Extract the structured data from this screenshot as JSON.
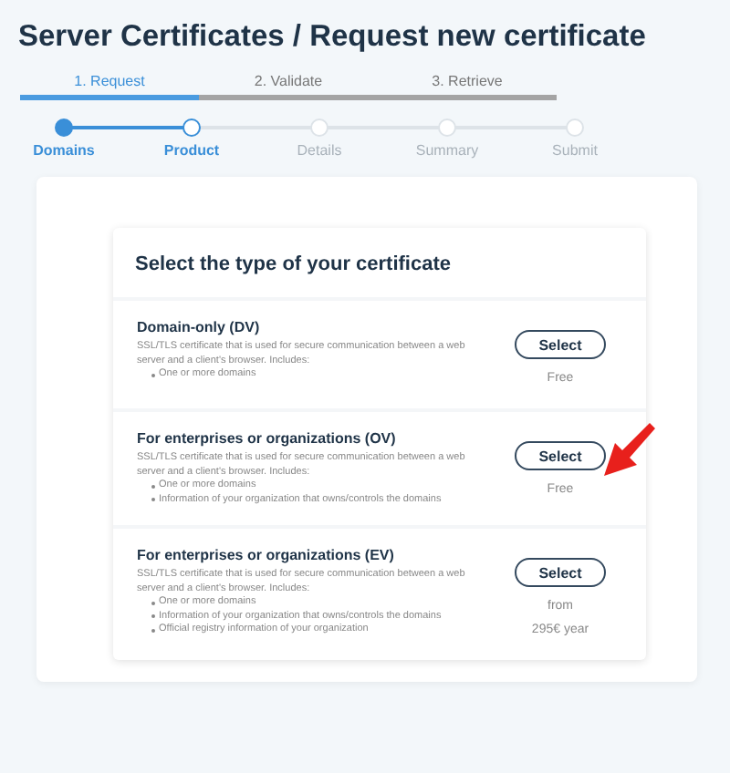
{
  "page_title": "Server Certificates / Request new certificate",
  "tabs": [
    {
      "label": "1. Request",
      "selected": true
    },
    {
      "label": "2. Validate",
      "selected": false
    },
    {
      "label": "3. Retrieve",
      "selected": false
    }
  ],
  "steps": [
    {
      "label": "Domains",
      "kind": "done"
    },
    {
      "label": "Product",
      "kind": "current"
    },
    {
      "label": "Details",
      "kind": "upcoming"
    },
    {
      "label": "Summary",
      "kind": "upcoming"
    },
    {
      "label": "Submit",
      "kind": "upcoming"
    }
  ],
  "card_title": "Select the type of your certificate",
  "options": [
    {
      "name": "Domain-only (DV)",
      "description": "SSL/TLS certificate that is used for secure communication between a web server and a client's browser. Includes:",
      "features": [
        "One or more domains"
      ],
      "button": "Select",
      "price": [
        "Free"
      ]
    },
    {
      "name": "For enterprises or organizations (OV)",
      "description": "SSL/TLS certificate that is used for secure communication between a web server and a client's browser. Includes:",
      "features": [
        "One or more domains",
        "Information of your organization that owns/controls the domains"
      ],
      "button": "Select",
      "price": [
        "Free"
      ]
    },
    {
      "name": "For enterprises or organizations (EV)",
      "description": "SSL/TLS certificate that is used for secure communication between a web server and a client's browser. Includes:",
      "features": [
        "One or more domains",
        "Information of your organization that owns/controls the domains",
        "Official registry information of your organization"
      ],
      "button": "Select",
      "price": [
        "from",
        "295€ year"
      ]
    }
  ]
}
